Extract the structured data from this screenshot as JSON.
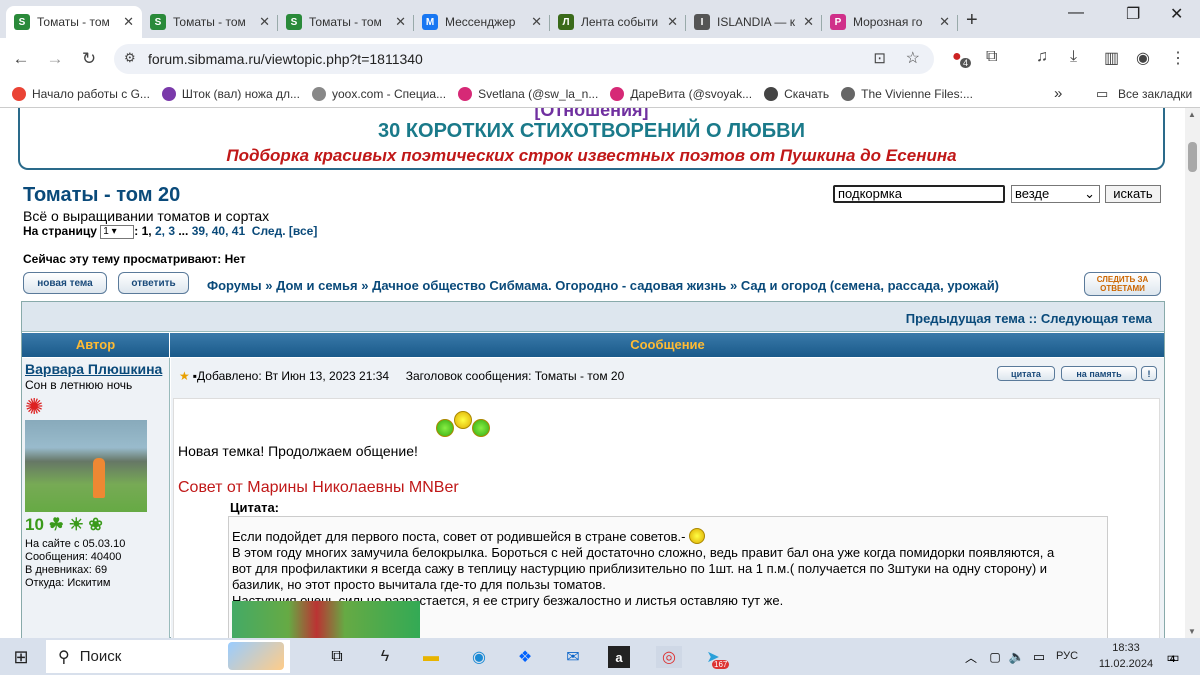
{
  "browser": {
    "tabs": [
      {
        "label": "Томаты - том",
        "color": "#2a8a3a",
        "glyph": "S",
        "active": true
      },
      {
        "label": "Томаты - том",
        "color": "#2a8a3a",
        "glyph": "S",
        "active": false
      },
      {
        "label": "Томаты - том",
        "color": "#2a8a3a",
        "glyph": "S",
        "active": false
      },
      {
        "label": "Мессенджер",
        "color": "#1877f2",
        "glyph": "M",
        "active": false
      },
      {
        "label": "Лента событи",
        "color": "#3a6a1a",
        "glyph": "Л",
        "active": false
      },
      {
        "label": "ISLANDIA — к",
        "color": "#555555",
        "glyph": "I",
        "active": false
      },
      {
        "label": "Морозная го",
        "color": "#d0308a",
        "glyph": "P",
        "active": false
      }
    ],
    "new_tab": "+",
    "url": "forum.sibmama.ru/viewtopic.php?t=1811340",
    "extension_badge": "4",
    "bookmarks": [
      {
        "label": "Начало работы с G...",
        "color": "#ea4335"
      },
      {
        "label": "Шток (вал) ножа дл...",
        "color": "#7a3aaa"
      },
      {
        "label": "yoox.com - Специа...",
        "color": "#888888"
      },
      {
        "label": "Svetlana (@sw_la_n...",
        "color": "#d62976"
      },
      {
        "label": "ДареВита (@svoyak...",
        "color": "#d62976"
      },
      {
        "label": "Скачать",
        "color": "#444444"
      },
      {
        "label": "The Vivienne Files:...",
        "color": "#666666"
      }
    ],
    "all_bookmarks": "Все закладки",
    "more": "»"
  },
  "banner": {
    "top": "[Отношения]",
    "title": "30 КОРОТКИХ СТИХОТВОРЕНИЙ О ЛЮБВИ",
    "subtitle": "Подборка красивых поэтических строк известных поэтов от Пушкина до Есенина"
  },
  "topic": {
    "title": "Томаты - том 20",
    "description": "Всё о выращивании томатов и сортах",
    "pages_label": "На страницу",
    "page_select": "1",
    "pages_text": ":",
    "page_current": "1,",
    "page_links": [
      "2,",
      "3"
    ],
    "ellipsis": "...",
    "page_links_end": [
      "39,",
      "40,",
      "41"
    ],
    "next": "След.",
    "all": "[все]",
    "viewers": "Сейчас эту тему просматривают: Нет"
  },
  "search": {
    "value": "подкормка",
    "scope": "везде",
    "button": "искать"
  },
  "buttons": {
    "new_topic": "новая тема",
    "reply": "ответить",
    "watch": "СЛЕДИТЬ ЗА ОТВЕТАМИ",
    "quote": "цитата",
    "memo": "на память",
    "report": "!"
  },
  "breadcrumbs": [
    "Форумы",
    "Дом и семья",
    "Дачное общество Сибмама. Огородно - садовая жизнь",
    "Сад и огород (семена, рассада, урожай)"
  ],
  "crumb_sep": "»",
  "table": {
    "prev_topic": "Предыдущая тема",
    "sep": "::",
    "next_topic": "Следующая тема",
    "col_author": "Автор",
    "col_message": "Сообщение"
  },
  "post": {
    "author": "Варвара Плюшкина",
    "rank": "Сон в летнюю ночь",
    "badges": "10 ☘ ☀ ❀",
    "since": "На сайте с 05.03.10",
    "messages": "Сообщения: 40400",
    "diaries": "В дневниках: 69",
    "from": "Откуда: Искитим",
    "added": "Добавлено: Вт Июн 13, 2023 21:34",
    "subject": "Заголовок сообщения: Томаты - том 20",
    "line1": "Новая темка! Продолжаем общение!",
    "line2": "Совет от Марины Николаевны MNBer",
    "quote_label": "Цитата:",
    "quote_lines": [
      "Если подойдет для первого поста, совет от родившейся в стране советов.-",
      "В этом году многих замучила белокрылка. Бороться с ней достаточно сложно, ведь правит бал она уже когда помидорки появляются, а",
      "вот для профилактики я всегда сажу в теплицу настурцию приблизительно по 1шт. на 1 п.м.( получается по 3штуки на одну сторону) и",
      "базилик, но этот просто вычитала где-то для пользы томатов.",
      "Настурция очень сильно разрастается, я ее стригу безжалостно и листья оставляю тут же."
    ]
  },
  "taskbar": {
    "search": "Поиск",
    "lang": "РУС",
    "time": "18:33",
    "date": "11.02.2024",
    "telegram_badge": "167",
    "notif_badge": "4"
  }
}
